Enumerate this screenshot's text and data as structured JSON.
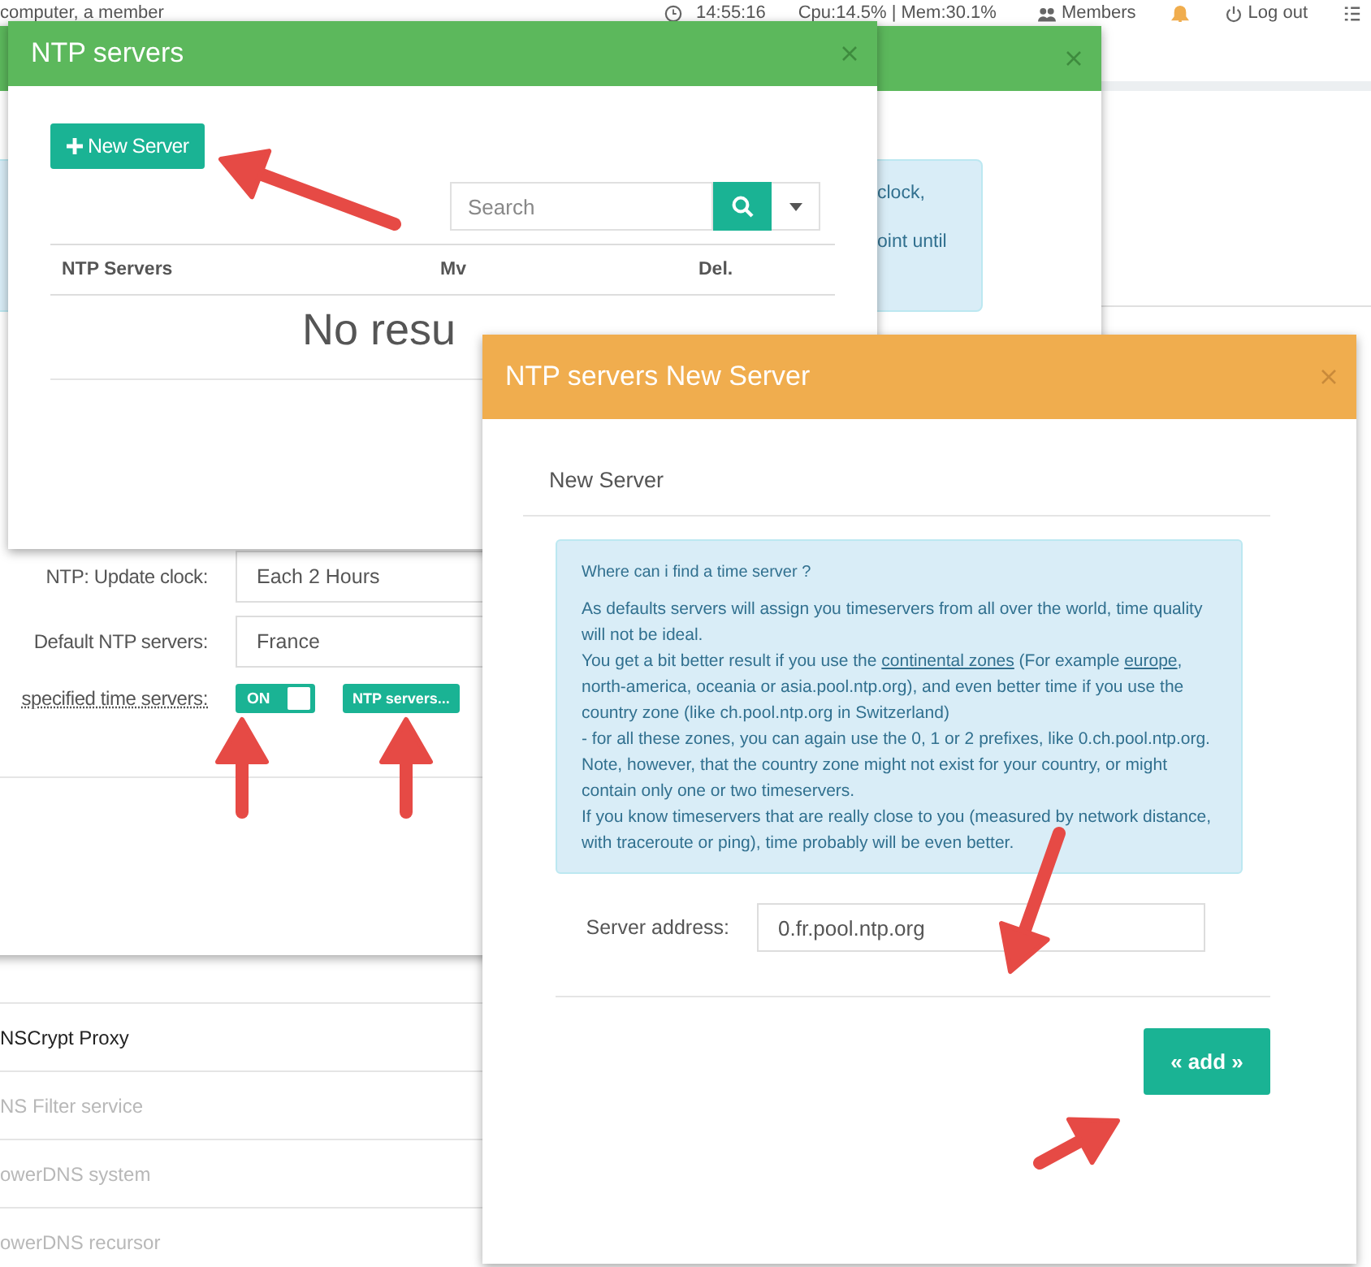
{
  "top_bar": {
    "user": "computer, a member",
    "time": "14:55:16",
    "stats": "Cpu:14.5% | Mem:30.1%",
    "members": "Members",
    "logout": "Log out"
  },
  "page_list": [
    {
      "label": "NSCrypt Proxy",
      "disabled": false
    },
    {
      "label": "NS Filter service",
      "disabled": true
    },
    {
      "label": "owerDNS system",
      "disabled": true
    },
    {
      "label": "owerDNS recursor",
      "disabled": true
    }
  ],
  "settings_dialog": {
    "info_fragments": [
      "clock,",
      "oint until"
    ],
    "fields": [
      {
        "kind": "select",
        "label": "NTP: Update clock:",
        "value": "Each 2 Hours"
      },
      {
        "kind": "select",
        "label": "Default NTP servers:",
        "value": "France"
      },
      {
        "kind": "toggle",
        "label": "specified time servers:",
        "toggle_text": "ON",
        "on": true,
        "button": "NTP servers..."
      }
    ]
  },
  "servers_dialog": {
    "title": "NTP servers",
    "new_button": "New Server",
    "search": {
      "placeholder": "Search"
    },
    "columns": [
      "NTP Servers",
      "Mv",
      "Del."
    ],
    "empty_text": "No resu"
  },
  "add_dialog": {
    "title": "NTP servers New Server",
    "section": "New Server",
    "info": {
      "heading": "Where can i find a time server ?",
      "paragraphs": [
        [
          {
            "kind": "text",
            "text": "As defaults servers will assign you timeservers from all over the world, time quality will not be ideal."
          }
        ],
        [
          {
            "kind": "text",
            "text": "You get a bit better result if you use the "
          },
          {
            "kind": "link",
            "text": "continental zones"
          },
          {
            "kind": "text",
            "text": " (For example "
          },
          {
            "kind": "link",
            "text": "europe"
          },
          {
            "kind": "text",
            "text": ", north-america, oceania or asia.pool.ntp.org), and even better time if you use the country zone (like ch.pool.ntp.org in Switzerland)"
          }
        ],
        [
          {
            "kind": "text",
            "text": "- for all these zones, you can again use the 0, 1 or 2 prefixes, like 0.ch.pool.ntp.org."
          }
        ],
        [
          {
            "kind": "text",
            "text": "Note, however, that the country zone might not exist for your country, or might contain only one or two timeservers."
          }
        ],
        [
          {
            "kind": "text",
            "text": "If you know timeservers that are really close to you (measured by network distance, with traceroute or ping), time probably will be even better."
          }
        ]
      ]
    },
    "field": {
      "label": "Server address:",
      "value": "0.fr.pool.ntp.org"
    },
    "button": "« add »"
  }
}
